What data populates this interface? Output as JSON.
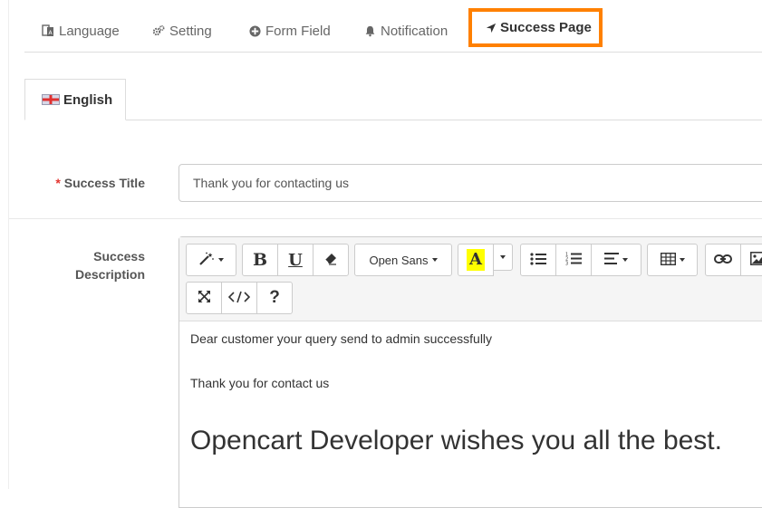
{
  "tabs": [
    {
      "label": "Language",
      "icon": "language-icon"
    },
    {
      "label": "Setting",
      "icon": "gears-icon"
    },
    {
      "label": "Form Field",
      "icon": "plus-circle-icon"
    },
    {
      "label": "Notification",
      "icon": "bell-icon"
    },
    {
      "label": "Success Page",
      "icon": "location-arrow-icon",
      "active": true
    }
  ],
  "language_tab": {
    "label": "English",
    "flag": "uk-flag-icon"
  },
  "form": {
    "success_title": {
      "required_mark": "*",
      "label": "Success Title",
      "value": "Thank you for contacting us"
    },
    "success_description": {
      "label_line1": "Success",
      "label_line2": "Description"
    }
  },
  "editor": {
    "font_select": "Open Sans",
    "content": {
      "line1": "Dear customer your query send to admin successfully",
      "line2": "Thank you for contact us",
      "heading": "Opencart Developer wishes you all the best."
    }
  },
  "colors": {
    "active_tab_border": "#ff8000",
    "required": "#e3342f",
    "highlight": "#ffff00"
  }
}
